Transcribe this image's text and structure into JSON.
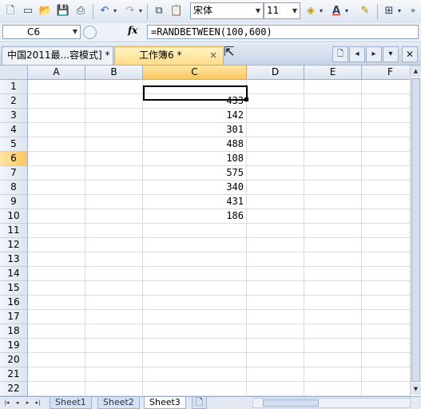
{
  "toolbar": {
    "font_name": "宋体",
    "font_size": "11",
    "icons": [
      "new-icon",
      "open-icon",
      "save-icon",
      "print-preview-icon",
      "undo-icon",
      "redo-icon",
      "copy-icon",
      "paste-icon",
      "fill-color-icon",
      "font-color-icon",
      "format-painter-icon",
      "borders-icon"
    ]
  },
  "formula_bar": {
    "cell_ref": "C6",
    "fx_label": "fx",
    "formula": "=RANDBETWEEN(100,600)"
  },
  "doc_tabs": [
    {
      "label": "中国2011最...容模式] *"
    },
    {
      "label": "工作簿6 *"
    }
  ],
  "doc_tab_close": "×",
  "columns": [
    "A",
    "B",
    "C",
    "D",
    "E",
    "F"
  ],
  "selected_column": "C",
  "rows": [
    "1",
    "2",
    "3",
    "4",
    "5",
    "6",
    "7",
    "8",
    "9",
    "10",
    "11",
    "12",
    "13",
    "14",
    "15",
    "16",
    "17",
    "18",
    "19",
    "20",
    "21",
    "22"
  ],
  "selected_row": "6",
  "column_c_values": [
    "",
    "433",
    "142",
    "301",
    "488",
    "108",
    "575",
    "340",
    "431",
    "186"
  ],
  "sheets": [
    "Sheet1",
    "Sheet2",
    "Sheet3"
  ],
  "active_sheet": "Sheet3",
  "colors": {
    "selection_header": "#fbc65e",
    "header": "#dce4f1",
    "gridline": "#dadcdd"
  }
}
